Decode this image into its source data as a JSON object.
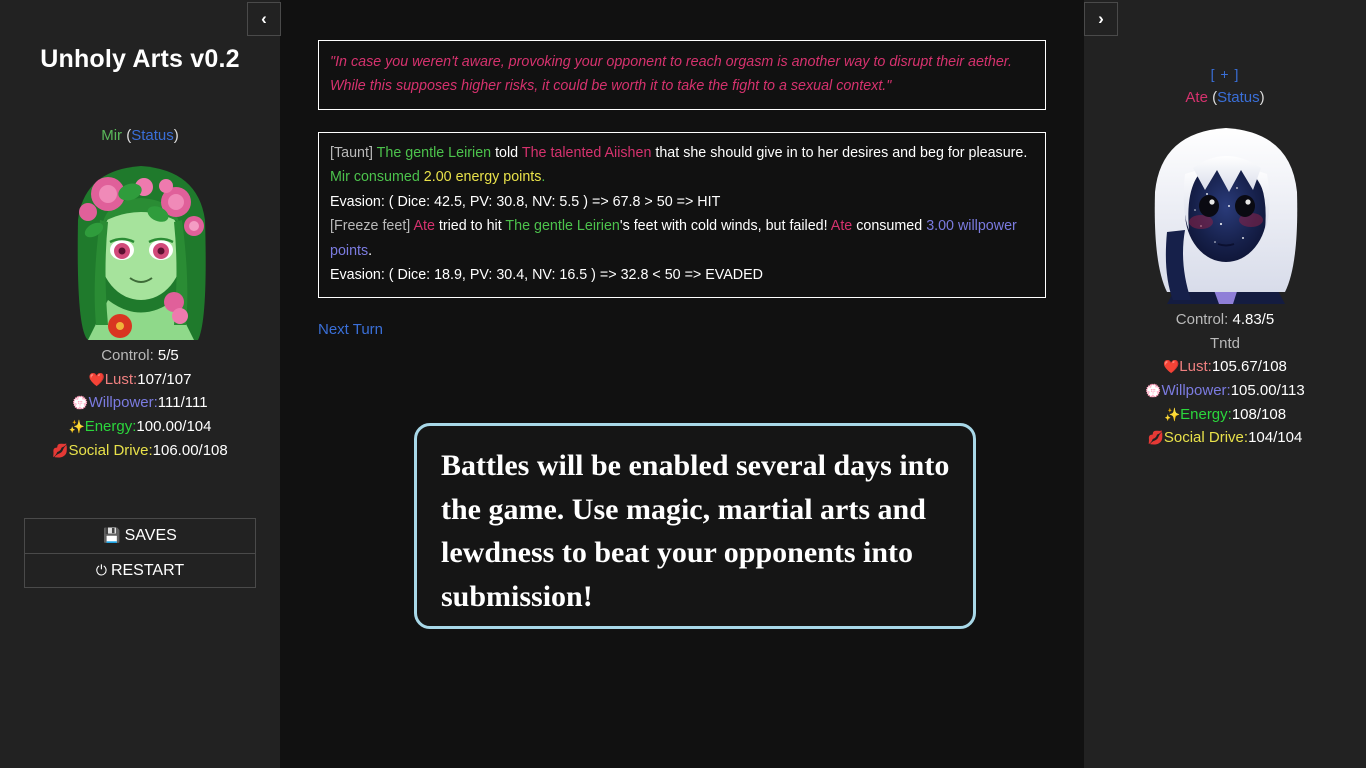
{
  "app": {
    "title": "Unholy Arts v0.2",
    "background": "#111111",
    "panel_background": "#222222"
  },
  "nav": {
    "left_arrow": "‹",
    "right_arrow": "›"
  },
  "left_character": {
    "name": "Mir",
    "status_label": "Status",
    "open_paren": "(",
    "close_paren": ")",
    "portrait_alt": "green-skinned woman with pink flower crown",
    "stats": {
      "control_label": "Control: ",
      "control_value": "5/5",
      "lust_icon": "❤️",
      "lust_label": "Lust:",
      "lust_value": "107/107",
      "willpower_icon": "💮",
      "willpower_label": "Willpower:",
      "willpower_value": "111/111",
      "energy_icon": "✨",
      "energy_label": "Energy:",
      "energy_value": "100.00/104",
      "social_icon": "💋",
      "social_label": "Social Drive:",
      "social_value": "106.00/108"
    }
  },
  "right_character": {
    "plus_label": "[ + ]",
    "name": "Ate",
    "status_label": "Status",
    "open_paren": "(",
    "close_paren": ")",
    "portrait_alt": "dark cosmic-skinned woman with white hair",
    "stats": {
      "control_label": "Control: ",
      "control_value": "4.83/5",
      "condition": "Tntd",
      "lust_icon": "❤️",
      "lust_label": "Lust:",
      "lust_value": "105.67/108",
      "willpower_icon": "💮",
      "willpower_label": "Willpower:",
      "willpower_value": "105.00/113",
      "energy_icon": "✨",
      "energy_label": "Energy:",
      "energy_value": "108/108",
      "social_icon": "💋",
      "social_label": "Social Drive:",
      "social_value": "104/104"
    }
  },
  "menu": {
    "saves_icon": "💾",
    "saves_label": "SAVES",
    "restart_icon": "⏻",
    "restart_label": "RESTART"
  },
  "hint": {
    "text": "\"In case you weren't aware, provoking your opponent to reach orgasm is another way to disrupt their aether. While this supposes higher risks, it could be worth it to take the fight to a sexual context.\""
  },
  "combat_log": {
    "entry1": {
      "tag": "[Taunt] ",
      "attacker": "The gentle Leirien",
      "verb": " told ",
      "target": "The talented Aiishen",
      "body": " that she should give in to her desires and beg for pleasure. ",
      "consumer": "Mir",
      "consumed_word": " consumed ",
      "cost_amount": "2.00 energy points",
      "period": "."
    },
    "evasion1": "Evasion: ( Dice: 42.5, PV: 30.8, NV: 5.5 ) => 67.8 > 50 => HIT",
    "entry2": {
      "tag": "[Freeze feet] ",
      "attacker": "Ate",
      "verb": " tried to hit ",
      "target": "The gentle Leirien",
      "body": "'s feet with cold winds, but failed! ",
      "consumer": "Ate",
      "consumed_word": " consumed ",
      "cost_amount": "3.00 willpower points",
      "period": "."
    },
    "evasion2": "Evasion: ( Dice: 18.9, PV: 30.4, NV: 16.5 ) => 32.8 < 50 => EVADED"
  },
  "next_turn": {
    "label": "Next Turn"
  },
  "tooltip": {
    "text": "Battles will be enabled several days into the game. Use magic, martial arts and lewdness to beat your opponents into submission!",
    "border_color": "#a8d8e8"
  },
  "colors": {
    "link": "#3a6fd8",
    "green_name": "#4cc24c",
    "pink_name": "#d6326e",
    "lust": "#ef8080",
    "willpower": "#7b7be0",
    "energy": "#2bd63c",
    "social": "#e8e14a"
  }
}
